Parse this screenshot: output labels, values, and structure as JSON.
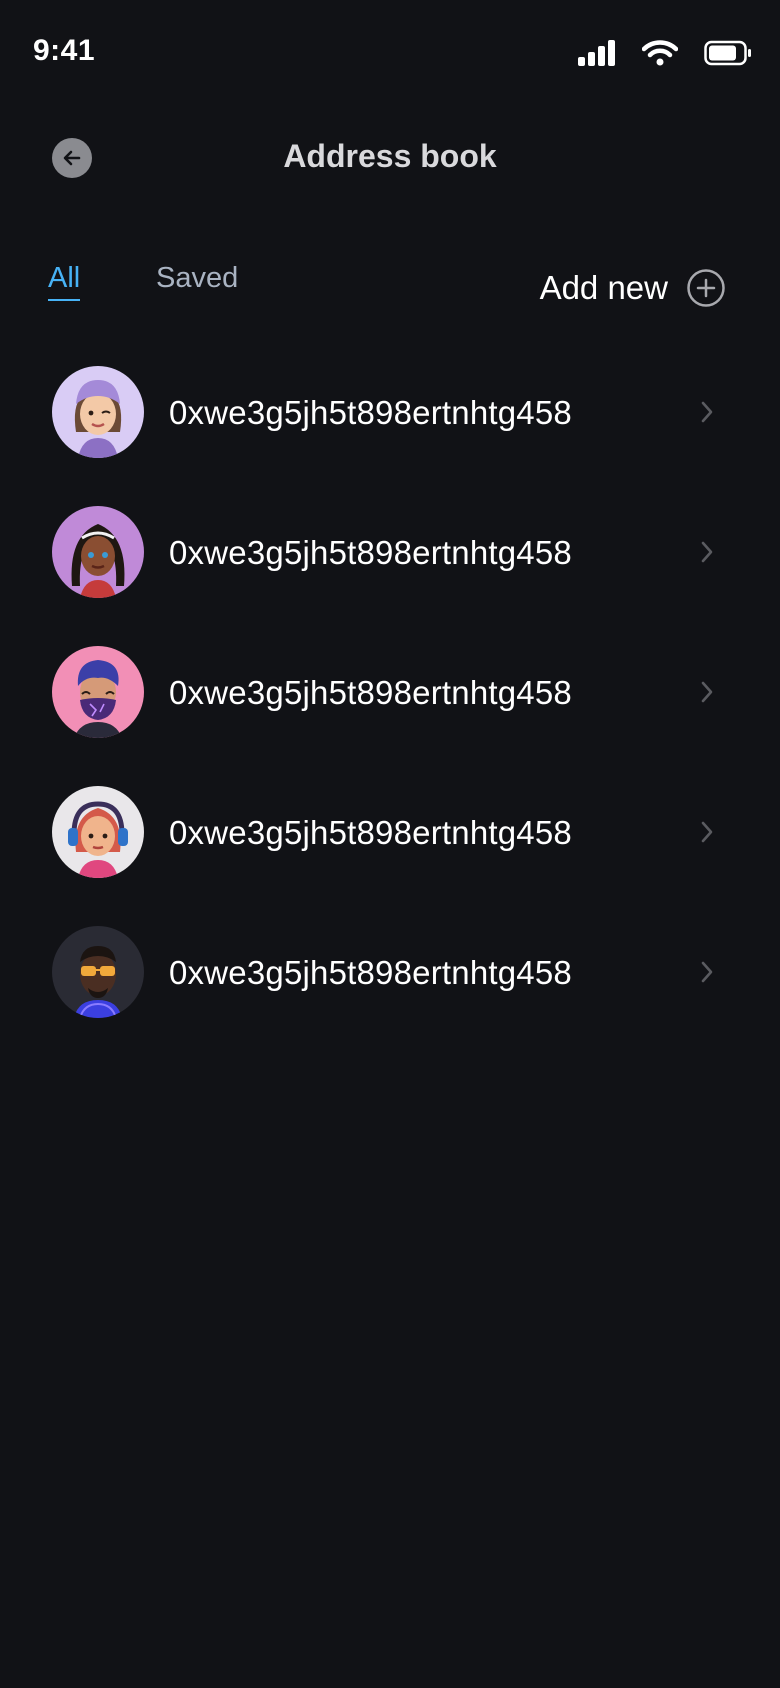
{
  "status_bar": {
    "time": "9:41"
  },
  "header": {
    "title": "Address book"
  },
  "tabs": [
    {
      "label": "All",
      "active": true
    },
    {
      "label": "Saved",
      "active": false
    }
  ],
  "add_new": {
    "label": "Add new"
  },
  "contacts": [
    {
      "address": "0xwe3g5jh5t898ertnhtg458",
      "avatar": "avatar-woman-purple-beanie"
    },
    {
      "address": "0xwe3g5jh5t898ertnhtg458",
      "avatar": "avatar-woman-braids"
    },
    {
      "address": "0xwe3g5jh5t898ertnhtg458",
      "avatar": "avatar-man-purple-mask"
    },
    {
      "address": "0xwe3g5jh5t898ertnhtg458",
      "avatar": "avatar-woman-headphones"
    },
    {
      "address": "0xwe3g5jh5t898ertnhtg458",
      "avatar": "avatar-man-yellow-glasses"
    }
  ],
  "colors": {
    "background": "#111216",
    "accent": "#47b2f5",
    "tab_inactive": "#a9b3c2",
    "title": "#d9d9dc"
  }
}
